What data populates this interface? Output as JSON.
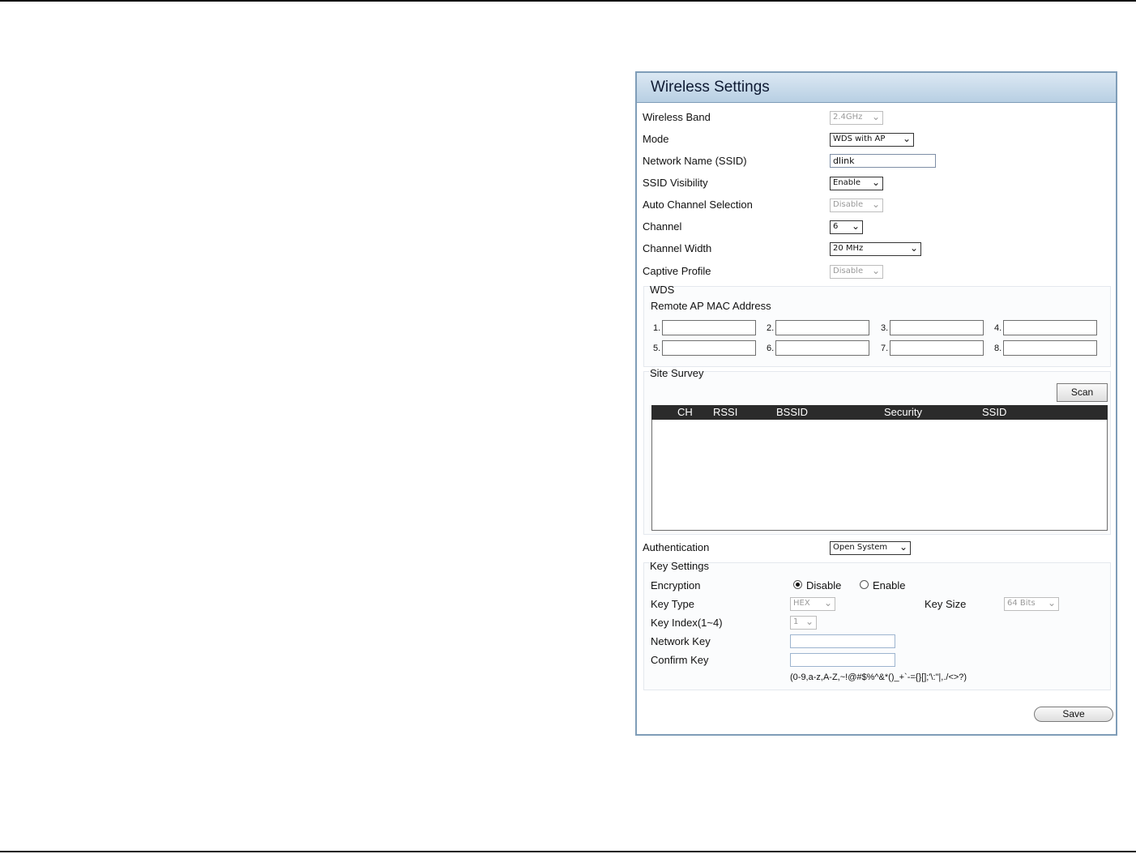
{
  "panel": {
    "title": "Wireless Settings"
  },
  "fields": {
    "wireless_band": {
      "label": "Wireless Band",
      "value": "2.4GHz"
    },
    "mode": {
      "label": "Mode",
      "value": "WDS with AP"
    },
    "ssid": {
      "label": "Network Name (SSID)",
      "value": "dlink"
    },
    "ssid_visibility": {
      "label": "SSID Visibility",
      "value": "Enable"
    },
    "auto_channel": {
      "label": "Auto Channel Selection",
      "value": "Disable"
    },
    "channel": {
      "label": "Channel",
      "value": "6"
    },
    "channel_width": {
      "label": "Channel Width",
      "value": "20 MHz"
    },
    "captive_profile": {
      "label": "Captive Profile",
      "value": "Disable"
    }
  },
  "wds": {
    "title": "WDS",
    "remote_label": "Remote AP MAC Address",
    "slots": [
      "1.",
      "2.",
      "3.",
      "4.",
      "5.",
      "6.",
      "7.",
      "8."
    ]
  },
  "site_survey": {
    "title": "Site Survey",
    "scan_label": "Scan",
    "columns": [
      "CH",
      "RSSI",
      "BSSID",
      "Security",
      "SSID"
    ]
  },
  "authentication": {
    "label": "Authentication",
    "value": "Open System"
  },
  "key_settings": {
    "title": "Key Settings",
    "encryption_label": "Encryption",
    "encryption_options": [
      "Disable",
      "Enable"
    ],
    "encryption_selected": "Disable",
    "key_type_label": "Key Type",
    "key_type_value": "HEX",
    "key_size_label": "Key Size",
    "key_size_value": "64 Bits",
    "key_index_label": "Key Index(1~4)",
    "key_index_value": "1",
    "network_key_label": "Network Key",
    "confirm_key_label": "Confirm Key",
    "allowed_chars": "(0-9,a-z,A-Z,~!@#$%^&*()_+`-={}[];'\\:\"|,./<>?)"
  },
  "save_label": "Save",
  "colors": {
    "header_gradient_top": "#dbe8f3",
    "header_gradient_bottom": "#b8cfe3",
    "panel_border": "#7f9db8",
    "table_header": "#2b2b2b"
  }
}
